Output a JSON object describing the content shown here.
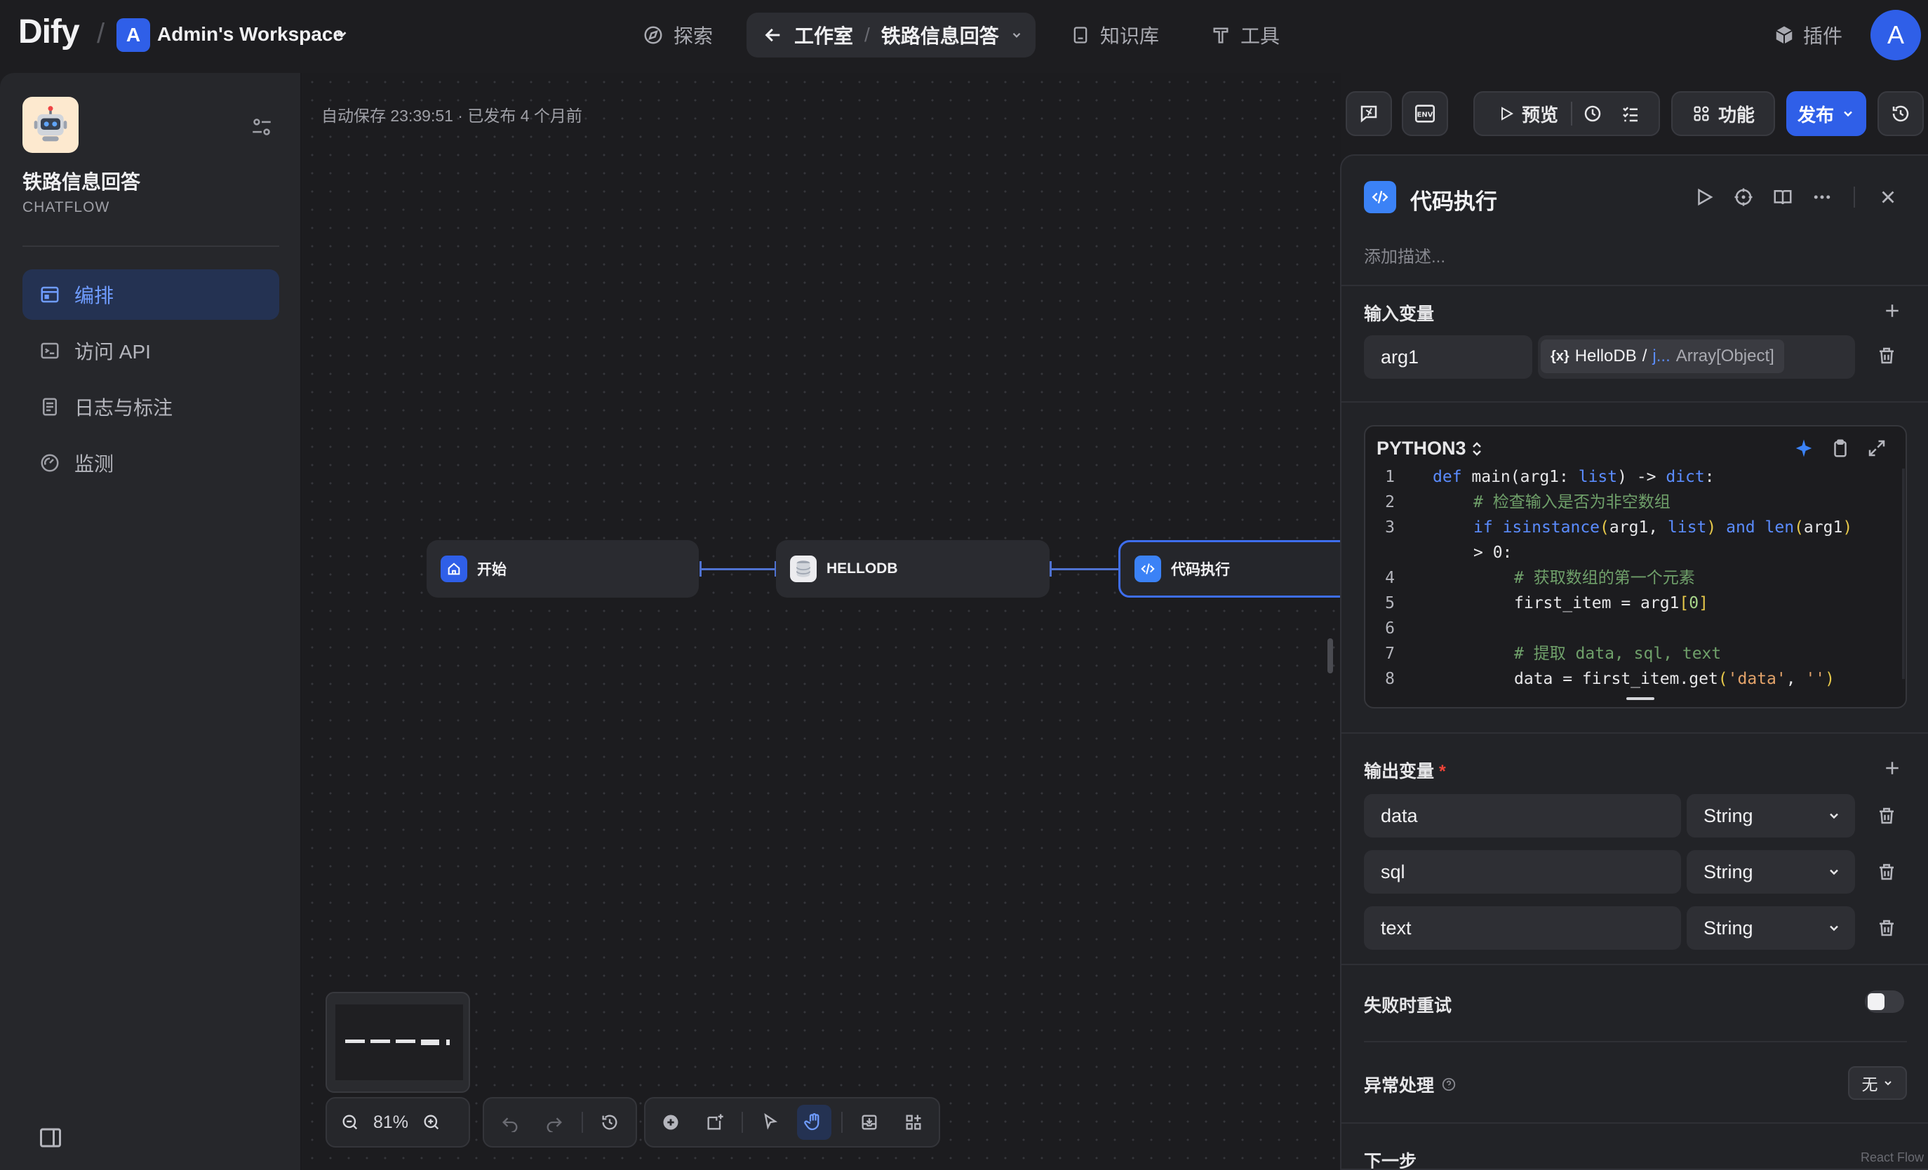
{
  "header": {
    "logo": "Dify",
    "workspace_avatar": "A",
    "workspace_name": "Admin's Workspace",
    "nav": {
      "explore": "探索",
      "studio": "工作室",
      "current_app": "铁路信息回答",
      "knowledge": "知识库",
      "tools": "工具"
    },
    "plugins": "插件",
    "user_avatar": "A"
  },
  "sidebar": {
    "app_name": "铁路信息回答",
    "app_type": "CHATFLOW",
    "items": [
      {
        "label": "编排",
        "icon": "orchestrate-icon",
        "active": true
      },
      {
        "label": "访问 API",
        "icon": "terminal-icon",
        "active": false
      },
      {
        "label": "日志与标注",
        "icon": "log-icon",
        "active": false
      },
      {
        "label": "监测",
        "icon": "monitor-icon",
        "active": false
      }
    ]
  },
  "canvas": {
    "autosave": "自动保存 23:39:51 · 已发布 4 个月前",
    "nodes": [
      {
        "label": "开始",
        "icon": "home-icon"
      },
      {
        "label": "HELLODB",
        "icon": "database-icon"
      },
      {
        "label": "代码执行",
        "icon": "code-icon",
        "selected": true
      }
    ],
    "zoom": "81%",
    "react_flow": "React Flow"
  },
  "toolbar": {
    "env": "ENV",
    "preview": "预览",
    "features": "功能",
    "publish": "发布"
  },
  "panel": {
    "title": "代码执行",
    "description_placeholder": "添加描述...",
    "input_section": "输入变量",
    "input_var_name": "arg1",
    "input_var_ref": {
      "source": "HelloDB",
      "separator": "/",
      "var": "j...",
      "type": "Array[Object]"
    },
    "language": "PYTHON3",
    "code": [
      {
        "n": "1",
        "text": "def main(arg1: list) -> dict:"
      },
      {
        "n": "2",
        "text": "# 检查输入是否为非空数组"
      },
      {
        "n": "3",
        "text": "if isinstance(arg1, list) and len(arg1)"
      },
      {
        "n": "",
        "text": "> 0:"
      },
      {
        "n": "4",
        "text": "# 获取数组的第一个元素"
      },
      {
        "n": "5",
        "text": "first_item = arg1[0]"
      },
      {
        "n": "6",
        "text": ""
      },
      {
        "n": "7",
        "text": "# 提取 data, sql, text"
      },
      {
        "n": "8",
        "text": "data = first_item.get('data', '')"
      }
    ],
    "output_section": "输出变量",
    "required_mark": "*",
    "outputs": [
      {
        "name": "data",
        "type": "String"
      },
      {
        "name": "sql",
        "type": "String"
      },
      {
        "name": "text",
        "type": "String"
      }
    ],
    "retry_label": "失败时重试",
    "error_label": "异常处理",
    "error_value": "无",
    "next_step": "下一步"
  },
  "colors": {
    "accent": "#2f5fe8",
    "active_bg": "#243252",
    "link": "#6f9cff"
  }
}
